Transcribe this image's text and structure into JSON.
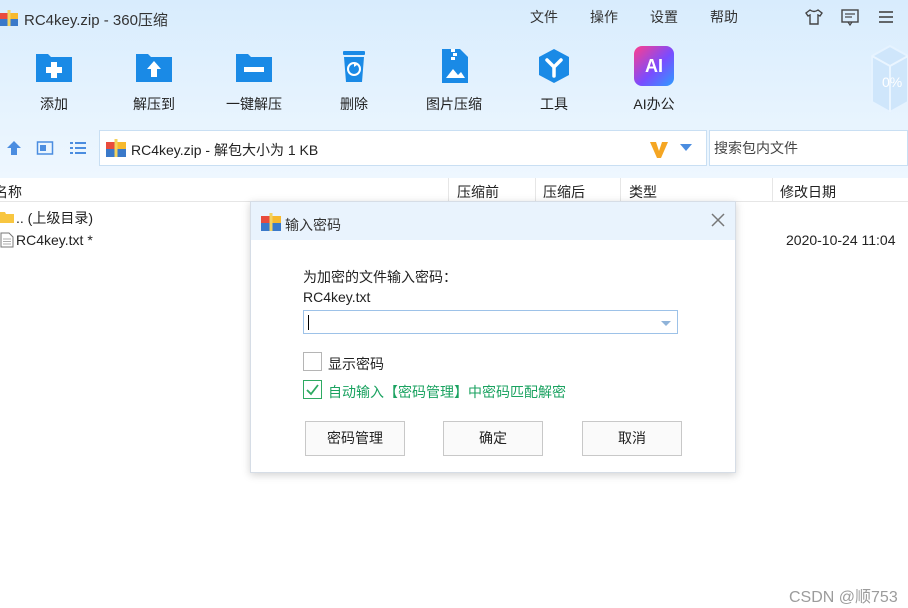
{
  "window": {
    "title": "RC4key.zip - 360压缩",
    "menu": [
      "文件",
      "操作",
      "设置",
      "帮助"
    ],
    "title_icons": [
      "shirt-icon",
      "message-icon",
      "menu-icon"
    ]
  },
  "toolbar": {
    "items": [
      {
        "label": "添加",
        "icon": "add-icon"
      },
      {
        "label": "解压到",
        "icon": "extract-to-icon"
      },
      {
        "label": "一键解压",
        "icon": "one-click-extract-icon"
      },
      {
        "label": "删除",
        "icon": "delete-icon"
      },
      {
        "label": "图片压缩",
        "icon": "image-compress-icon"
      },
      {
        "label": "工具",
        "icon": "tools-icon"
      },
      {
        "label": "AI办公",
        "icon": "ai-office-icon"
      }
    ],
    "ai_badge_text": "AI",
    "decoration_text": "0%"
  },
  "address": {
    "path": "RC4key.zip - 解包大小为 1 KB",
    "search_placeholder": "搜索包内文件"
  },
  "list": {
    "columns": [
      "名称",
      "压缩前",
      "压缩后",
      "类型",
      "修改日期"
    ],
    "rows": [
      {
        "name": ".. (上级目录)",
        "icon": "folder-icon",
        "date": ""
      },
      {
        "name": "RC4key.txt *",
        "icon": "text-file-icon",
        "date": "2020-10-24 11:04"
      }
    ]
  },
  "dialog": {
    "title": "输入密码",
    "prompt": "为加密的文件输入密码：",
    "filename": "RC4key.txt",
    "password_value": "",
    "show_password_label": "显示密码",
    "show_password_checked": false,
    "auto_input_label": "自动输入【密码管理】中密码匹配解密",
    "auto_input_checked": true,
    "buttons": {
      "manage": "密码管理",
      "ok": "确定",
      "cancel": "取消"
    }
  },
  "watermark": "CSDN @顺753",
  "colors": {
    "accent": "#1a8ae6",
    "toolbar_bg": "#dcedfd",
    "link_green": "#1aa260",
    "dialog_header": "#e9f3fd"
  }
}
